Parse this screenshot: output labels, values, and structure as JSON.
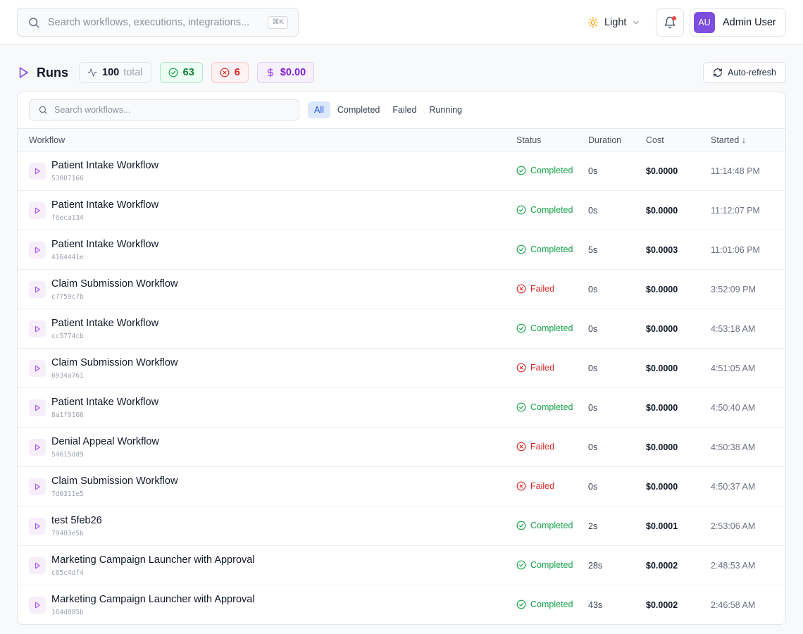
{
  "header": {
    "search_placeholder": "Search workflows, executions, integrations...",
    "shortcut": "⌘K",
    "theme_label": "Light",
    "user": {
      "initials": "AU",
      "name": "Admin User"
    }
  },
  "runs": {
    "title": "Runs",
    "total_count": "100",
    "total_label": "total",
    "completed_count": "63",
    "failed_count": "6",
    "total_cost": "$0.00",
    "auto_refresh_label": "Auto-refresh"
  },
  "filters": {
    "search_placeholder": "Search workflows...",
    "tabs": [
      "All",
      "Completed",
      "Failed",
      "Running"
    ],
    "active_tab": "All"
  },
  "table": {
    "columns": [
      "Workflow",
      "Status",
      "Duration",
      "Cost",
      "Started ↓"
    ],
    "rows": [
      {
        "name": "Patient Intake Workflow",
        "id": "53007166",
        "status": "Completed",
        "duration": "0s",
        "cost": "$0.0000",
        "started": "11:14:48 PM"
      },
      {
        "name": "Patient Intake Workflow",
        "id": "f6eca134",
        "status": "Completed",
        "duration": "0s",
        "cost": "$0.0000",
        "started": "11:12:07 PM"
      },
      {
        "name": "Patient Intake Workflow",
        "id": "4164441e",
        "status": "Completed",
        "duration": "5s",
        "cost": "$0.0003",
        "started": "11:01:06 PM"
      },
      {
        "name": "Claim Submission Workflow",
        "id": "c7759c7b",
        "status": "Failed",
        "duration": "0s",
        "cost": "$0.0000",
        "started": "3:52:09 PM"
      },
      {
        "name": "Patient Intake Workflow",
        "id": "cc5774cb",
        "status": "Completed",
        "duration": "0s",
        "cost": "$0.0000",
        "started": "4:53:18 AM"
      },
      {
        "name": "Claim Submission Workflow",
        "id": "6934a761",
        "status": "Failed",
        "duration": "0s",
        "cost": "$0.0000",
        "started": "4:51:05 AM"
      },
      {
        "name": "Patient Intake Workflow",
        "id": "8a1f9166",
        "status": "Completed",
        "duration": "0s",
        "cost": "$0.0000",
        "started": "4:50:40 AM"
      },
      {
        "name": "Denial Appeal Workflow",
        "id": "54615dd9",
        "status": "Failed",
        "duration": "0s",
        "cost": "$0.0000",
        "started": "4:50:38 AM"
      },
      {
        "name": "Claim Submission Workflow",
        "id": "7d0311e5",
        "status": "Failed",
        "duration": "0s",
        "cost": "$0.0000",
        "started": "4:50:37 AM"
      },
      {
        "name": "test 5feb26",
        "id": "79403e5b",
        "status": "Completed",
        "duration": "2s",
        "cost": "$0.0001",
        "started": "2:53:06 AM"
      },
      {
        "name": "Marketing Campaign Launcher with Approval",
        "id": "c85c4df4",
        "status": "Completed",
        "duration": "28s",
        "cost": "$0.0002",
        "started": "2:48:53 AM"
      },
      {
        "name": "Marketing Campaign Launcher with Approval",
        "id": "164d885b",
        "status": "Completed",
        "duration": "43s",
        "cost": "$0.0002",
        "started": "2:46:58 AM"
      }
    ]
  },
  "icons": {
    "header": [
      "search-icon",
      "sun-icon",
      "chevron-down-icon",
      "bell-icon"
    ],
    "runs": [
      "play-icon",
      "activity-icon",
      "check-circle-icon",
      "x-circle-icon",
      "dollar-icon",
      "refresh-icon"
    ]
  },
  "colors": {
    "accent": "#7c4ddf",
    "completed": "#16a34a",
    "failed": "#dc2626",
    "cost": "#7e22ce",
    "active_tab_bg": "#dbe8fd",
    "active_tab_text": "#1d4ed8"
  }
}
